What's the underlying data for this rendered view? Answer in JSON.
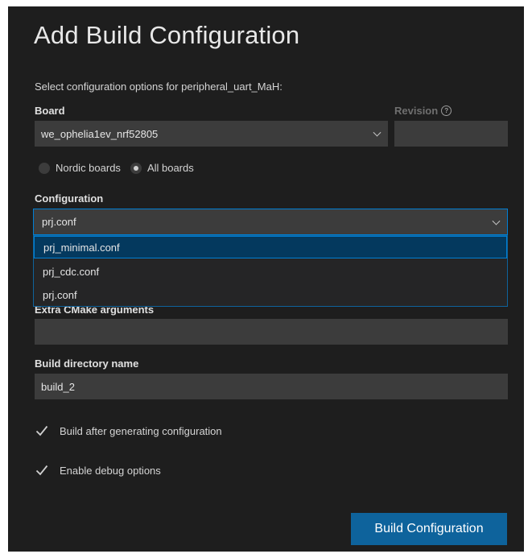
{
  "dialog": {
    "title": "Add Build Configuration",
    "subtitle": "Select configuration options for peripheral_uart_MaH:"
  },
  "board": {
    "label": "Board",
    "value": "we_ophelia1ev_nrf52805"
  },
  "revision": {
    "label": "Revision",
    "help_icon": "?",
    "value": ""
  },
  "board_filter": {
    "options": [
      {
        "label": "Nordic boards",
        "selected": false
      },
      {
        "label": "All boards",
        "selected": true
      }
    ]
  },
  "configuration": {
    "label": "Configuration",
    "value": "prj.conf",
    "options": [
      "prj_minimal.conf",
      "prj_cdc.conf",
      "prj.conf"
    ],
    "highlighted_option": "prj_minimal.conf"
  },
  "extra_cmake": {
    "label": "Extra CMake arguments",
    "value": ""
  },
  "build_dir": {
    "label": "Build directory name",
    "value": "build_2"
  },
  "checkboxes": {
    "build_after": {
      "label": "Build after generating configuration",
      "checked": true
    },
    "debug_options": {
      "label": "Enable debug options",
      "checked": true
    }
  },
  "buttons": {
    "build_configuration": "Build Configuration"
  },
  "colors": {
    "background": "#1e1e1e",
    "input": "#3c3c3c",
    "accent": "#0e639c",
    "focus_border": "#007fd4"
  }
}
